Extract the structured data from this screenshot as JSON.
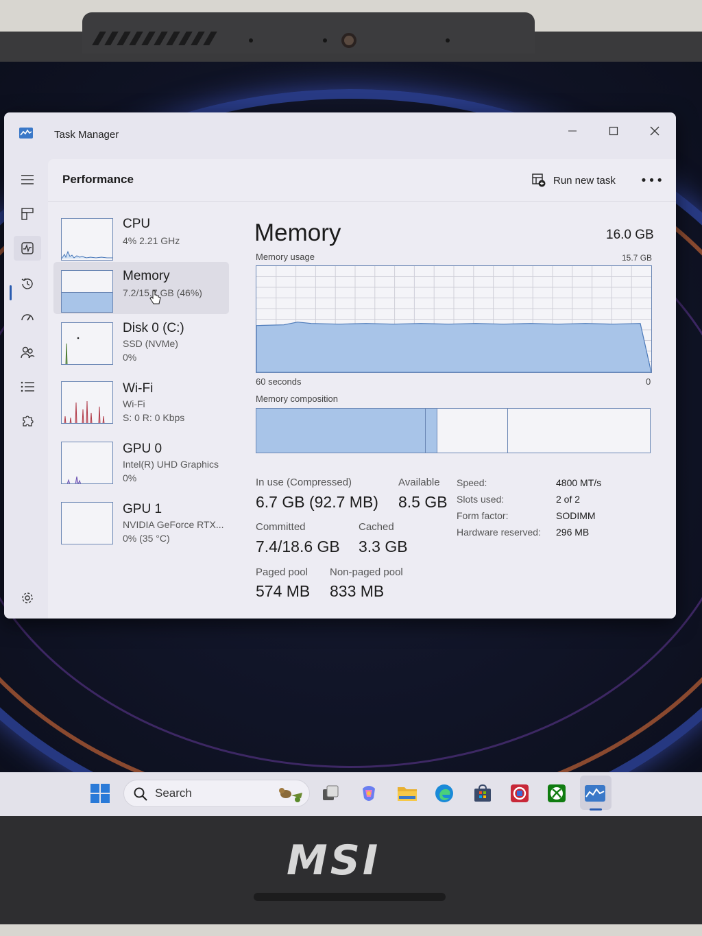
{
  "window": {
    "title": "Task Manager",
    "minimize_label": "—",
    "close_label": "✕"
  },
  "header": {
    "title": "Performance",
    "run_new_task": "Run new task",
    "more": "•••"
  },
  "devices": [
    {
      "name": "CPU",
      "line1": "4%  2.21 GHz",
      "line2": ""
    },
    {
      "name": "Memory",
      "line1": "7.2/15.7 GB (46%)",
      "line2": ""
    },
    {
      "name": "Disk 0 (C:)",
      "line1": "SSD (NVMe)",
      "line2": "0%"
    },
    {
      "name": "Wi-Fi",
      "line1": "Wi-Fi",
      "line2": "S: 0  R: 0 Kbps"
    },
    {
      "name": "GPU 0",
      "line1": "Intel(R) UHD Graphics",
      "line2": "0%"
    },
    {
      "name": "GPU 1",
      "line1": "NVIDIA GeForce RTX...",
      "line2": "0%  (35 °C)"
    }
  ],
  "memory": {
    "title": "Memory",
    "total": "16.0 GB",
    "usage_label": "Memory usage",
    "usage_max": "15.7 GB",
    "time_left": "60 seconds",
    "time_right": "0",
    "composition_label": "Memory composition",
    "usage_fraction": 0.46,
    "composition": {
      "in_use_fraction": 0.43,
      "modified_fraction": 0.03,
      "standby_fraction": 0.18
    },
    "stats": {
      "in_use_label": "In use (Compressed)",
      "in_use_value": "6.7 GB (92.7 MB)",
      "available_label": "Available",
      "available_value": "8.5 GB",
      "committed_label": "Committed",
      "committed_value": "7.4/18.6 GB",
      "cached_label": "Cached",
      "cached_value": "3.3 GB",
      "paged_label": "Paged pool",
      "paged_value": "574 MB",
      "nonpaged_label": "Non-paged pool",
      "nonpaged_value": "833 MB"
    },
    "details": [
      {
        "key": "Speed:",
        "value": "4800 MT/s"
      },
      {
        "key": "Slots used:",
        "value": "2 of 2"
      },
      {
        "key": "Form factor:",
        "value": "SODIMM"
      },
      {
        "key": "Hardware reserved:",
        "value": "296 MB"
      }
    ]
  },
  "taskbar": {
    "search_placeholder": "Search"
  },
  "brand": "MSI",
  "colors": {
    "accent": "#2a5cb0",
    "graph_fill": "#a8c4e8",
    "graph_line": "#6a86b4"
  }
}
